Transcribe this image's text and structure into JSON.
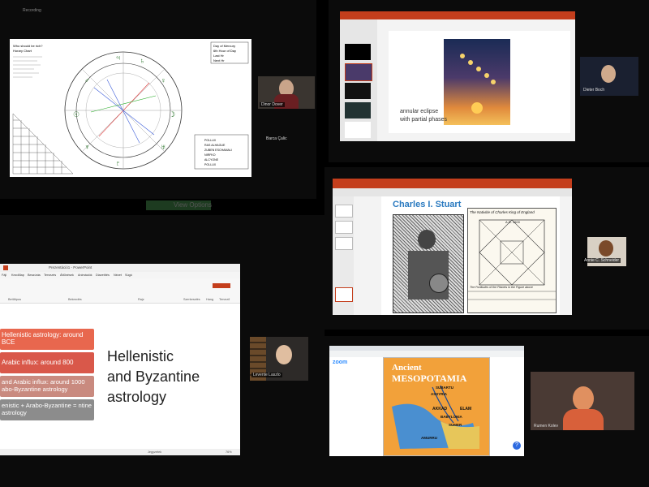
{
  "top_left": {
    "recording_label": "Recording",
    "chart_header": [
      "Who should be rich?",
      "Horary Chart"
    ],
    "chart_side_lines": [
      "Day of Mercury",
      "6th Hour of Day",
      "Last Hr",
      "Next Hr"
    ],
    "chart_stars": [
      "POLLUX",
      "RAS ALHAGUE",
      "ZUBEN ESCHAMALI",
      "NIRFKO",
      "ALCYONE",
      "POLLUX"
    ],
    "speaker1_name": "Dinor Dover",
    "speaker2_name": "Barca Çalic"
  },
  "top_right": {
    "slide_caption_line1": "annular eclipse",
    "slide_caption_line2": "with partial phases",
    "speaker_name": "Dieter Boch"
  },
  "middle_left": {
    "ghost_button": "View Options"
  },
  "middle_right": {
    "slide_title": "Charles I. Stuart",
    "chart_heading": "The Nativitie of Charles King of England",
    "chart_ad": "A.D. 1600",
    "chart_caption": "The Fortitudes of the Planets in the Figure above",
    "speaker_name": "Annie C. Schneider"
  },
  "bottom_left": {
    "window_title": "Prezentáció1 - PowerPoint",
    "ribbon_tabs": [
      "Fájl",
      "Kezdőlap",
      "Beszúrás",
      "Tervezés",
      "Áttűnések",
      "Animációk",
      "Diavetítés",
      "Nézet",
      "Súgó"
    ],
    "ribbon_groups": [
      "Betűtípus",
      "Bekezdés",
      "Rajz",
      "Szerkesztés",
      "Hang",
      "Tervező"
    ],
    "boxes": [
      "Hellenistic astrology: around BCE",
      "Arabic influx: around 800",
      "and Arabic influx: around 1000 abo-Byzantine astrology",
      "enistic + Arabo-Byzantine = ntine astrology"
    ],
    "title_line1": "Hellenistic",
    "title_line2": "and Byzantine",
    "title_line3": "astrology",
    "status_left": "Jegyzetek",
    "status_right": "76%",
    "speaker_name": "Levente Laszlo"
  },
  "bottom_right": {
    "app_name": "zoom",
    "slide_word1": "Ancient",
    "slide_word2": "MESOPOTAMIA",
    "map_labels": [
      "SUBARTU",
      "ASSYRIA",
      "AKKAD",
      "ELAM",
      "BABYLONIA",
      "SUMER",
      "AMURRU"
    ],
    "speaker_name": "Rumen Kolev"
  },
  "colors": {
    "box1": "#e8674e",
    "box2": "#d9584a",
    "box3": "#c98a7f",
    "box4": "#8c8c8c",
    "map_bg": "#f2a13a",
    "title_blue": "#2a7ac0",
    "ppt_red": "#c43e1c"
  }
}
